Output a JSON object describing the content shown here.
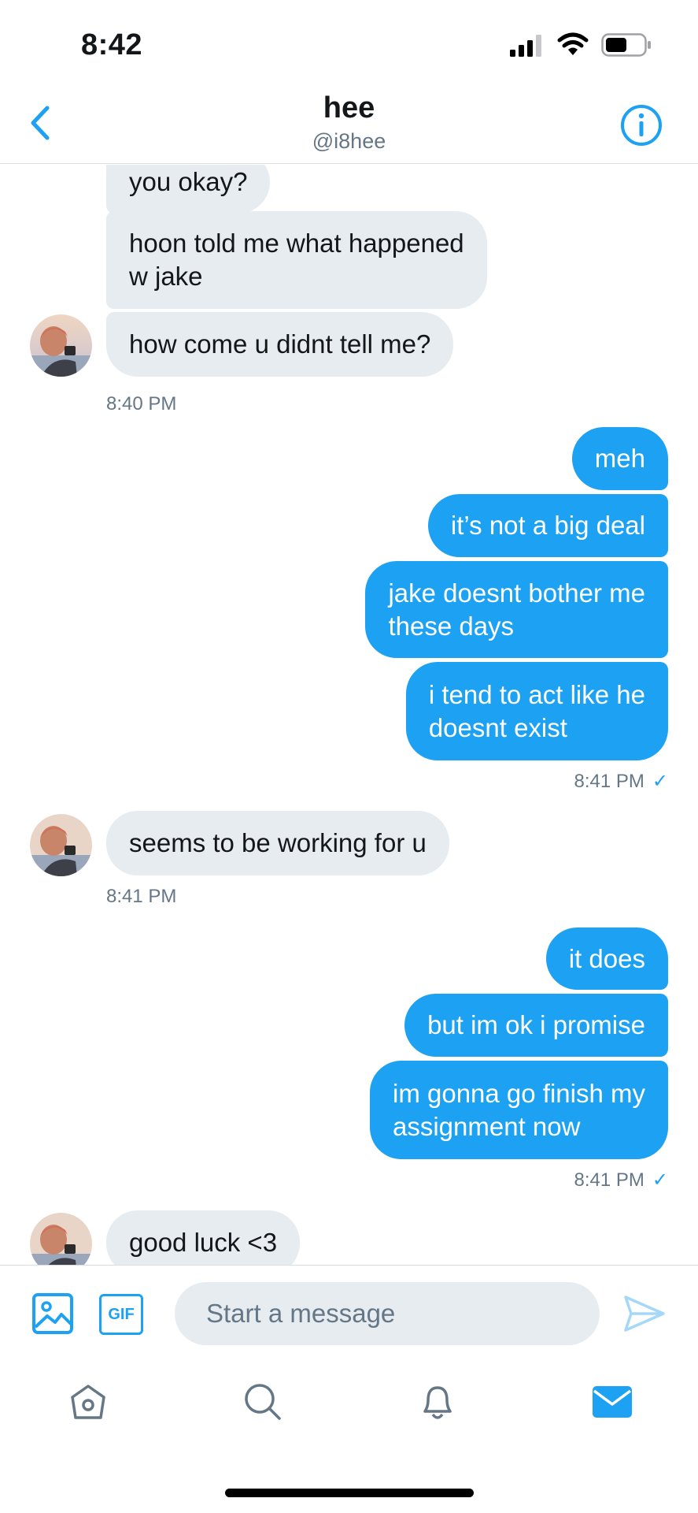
{
  "status_bar": {
    "time": "8:42"
  },
  "header": {
    "title": "hee",
    "handle": "@i8hee"
  },
  "conversation": {
    "incoming_1": {
      "bubbles": [
        "you okay?",
        "hoon told me what happened\nw jake",
        "how come u didnt tell me?"
      ],
      "time": "8:40 PM"
    },
    "outgoing_1": {
      "bubbles": [
        "meh",
        "it’s not a big deal",
        "jake doesnt bother me\nthese days",
        "i tend to act like he\ndoesnt exist"
      ],
      "time": "8:41 PM"
    },
    "incoming_2": {
      "bubbles": [
        "seems to be working for u"
      ],
      "time": "8:41 PM"
    },
    "outgoing_2": {
      "bubbles": [
        "it does",
        "but im ok i promise",
        "im gonna go finish my\nassignment now"
      ],
      "time": "8:41 PM"
    },
    "incoming_3": {
      "bubbles": [
        "good luck <3"
      ]
    }
  },
  "composer": {
    "gif_label": "GIF",
    "placeholder": "Start a message"
  },
  "colors": {
    "accent": "#1da1f2",
    "incoming_bubble": "#e6ecf0",
    "secondary_text": "#657786"
  },
  "icons": [
    "back-arrow",
    "info-circle",
    "image",
    "gif",
    "send",
    "home",
    "search",
    "bell",
    "mail"
  ]
}
